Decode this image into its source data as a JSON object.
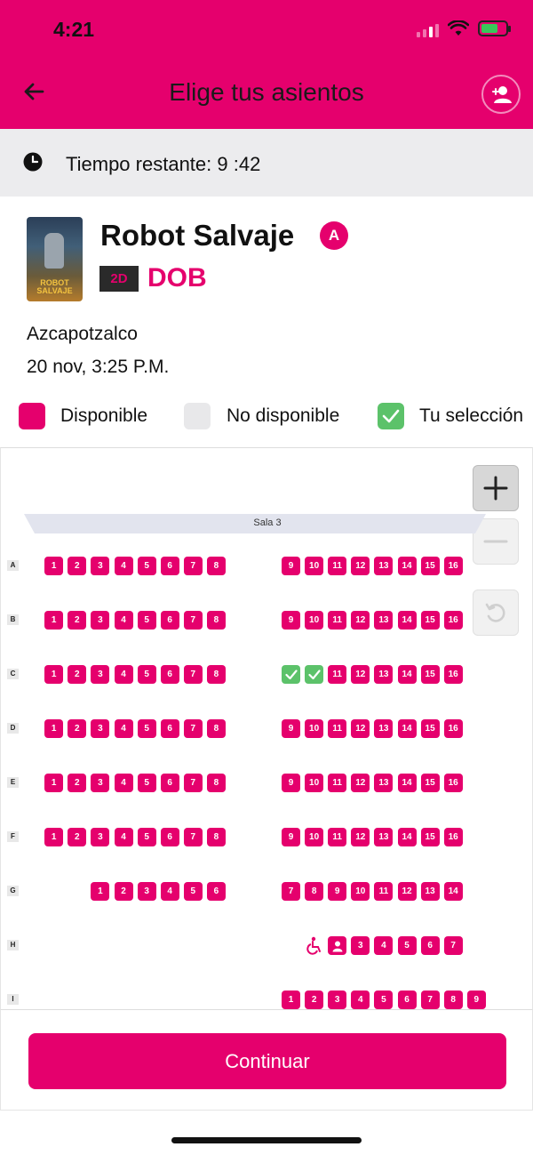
{
  "status": {
    "time": "4:21"
  },
  "header": {
    "title": "Elige tus asientos"
  },
  "timer": {
    "text": "Tiempo restante: 9 :42"
  },
  "movie": {
    "poster_text": "ROBOT SALVAJE",
    "title": "Robot Salvaje",
    "rating": "A",
    "format": "2D",
    "language": "DOB",
    "cinema": "Azcapotzalco",
    "datetime": "20 nov, 3:25 P.M."
  },
  "legend": {
    "available": "Disponible",
    "unavailable": "No disponible",
    "selected": "Tu selección"
  },
  "colors": {
    "brand": "#e5006d",
    "selected": "#5cc26a",
    "unavailable": "#e8e8ea"
  },
  "seatmap": {
    "screen_label": "Sala 3",
    "rows": [
      {
        "label": "A",
        "left": [
          "1",
          "2",
          "3",
          "4",
          "5",
          "6",
          "7",
          "8"
        ],
        "right": [
          "9",
          "10",
          "11",
          "12",
          "13",
          "14",
          "15",
          "16"
        ],
        "selected": []
      },
      {
        "label": "B",
        "left": [
          "1",
          "2",
          "3",
          "4",
          "5",
          "6",
          "7",
          "8"
        ],
        "right": [
          "9",
          "10",
          "11",
          "12",
          "13",
          "14",
          "15",
          "16"
        ],
        "selected": []
      },
      {
        "label": "C",
        "left": [
          "1",
          "2",
          "3",
          "4",
          "5",
          "6",
          "7",
          "8"
        ],
        "right": [
          "9",
          "10",
          "11",
          "12",
          "13",
          "14",
          "15",
          "16"
        ],
        "selected": [
          "9",
          "10"
        ]
      },
      {
        "label": "D",
        "left": [
          "1",
          "2",
          "3",
          "4",
          "5",
          "6",
          "7",
          "8"
        ],
        "right": [
          "9",
          "10",
          "11",
          "12",
          "13",
          "14",
          "15",
          "16"
        ],
        "selected": []
      },
      {
        "label": "E",
        "left": [
          "1",
          "2",
          "3",
          "4",
          "5",
          "6",
          "7",
          "8"
        ],
        "right": [
          "9",
          "10",
          "11",
          "12",
          "13",
          "14",
          "15",
          "16"
        ],
        "selected": []
      },
      {
        "label": "F",
        "left": [
          "1",
          "2",
          "3",
          "4",
          "5",
          "6",
          "7",
          "8"
        ],
        "right": [
          "9",
          "10",
          "11",
          "12",
          "13",
          "14",
          "15",
          "16"
        ],
        "selected": []
      },
      {
        "label": "G",
        "left": [
          "1",
          "2",
          "3",
          "4",
          "5",
          "6"
        ],
        "right": [
          "7",
          "8",
          "9",
          "10",
          "11",
          "12",
          "13",
          "14"
        ],
        "selected": []
      },
      {
        "label": "H",
        "left": [],
        "right": [
          "companion",
          "3",
          "4",
          "5",
          "6",
          "7"
        ],
        "selected": [],
        "wheelchair": true
      },
      {
        "label": "I",
        "left": [],
        "right": [
          "1",
          "2",
          "3",
          "4",
          "5",
          "6",
          "7",
          "8",
          "9"
        ],
        "selected": []
      }
    ]
  },
  "footer": {
    "continue_label": "Continuar"
  }
}
